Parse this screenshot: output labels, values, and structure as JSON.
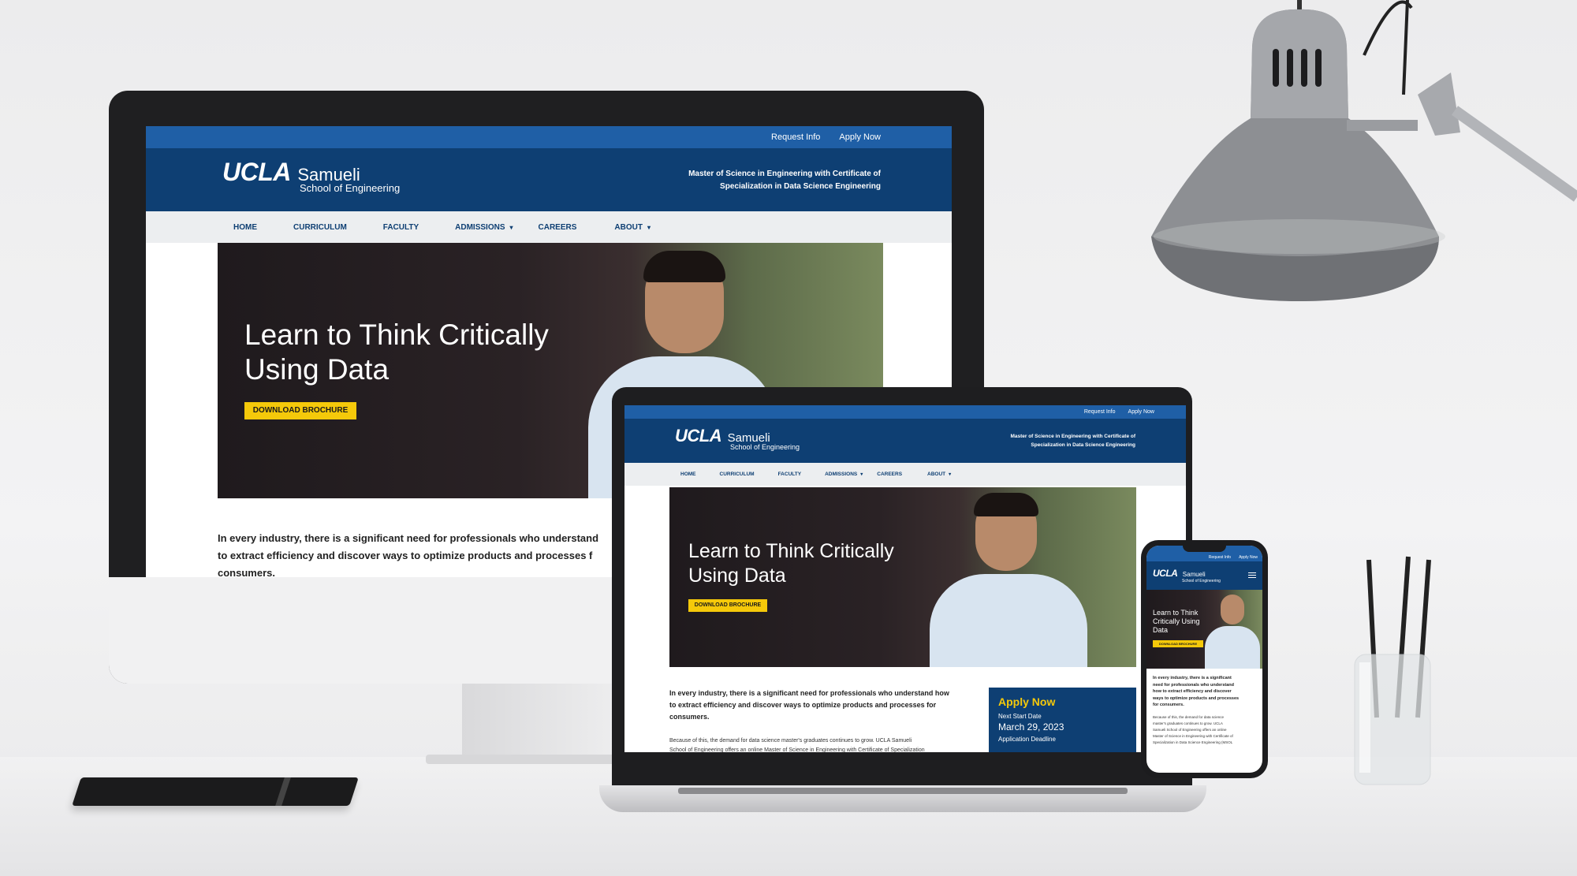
{
  "site": {
    "topbar": {
      "request_info": "Request Info",
      "apply_now": "Apply Now"
    },
    "logo": {
      "ucla": "UCLA",
      "samueli": "Samueli",
      "school": "School of Engineering"
    },
    "program": {
      "line1": "Master of Science in Engineering with Certificate of",
      "line2": "Specialization in Data Science Engineering"
    },
    "nav": [
      "HOME",
      "CURRICULUM",
      "FACULTY",
      "ADMISSIONS",
      "CAREERS",
      "ABOUT"
    ],
    "hero": {
      "headline_line1": "Learn to Think Critically",
      "headline_line2": "Using Data",
      "button": "DOWNLOAD BROCHURE"
    },
    "mobile_headline": {
      "line1": "Learn to Think",
      "line2": "Critically Using",
      "line3": "Data"
    },
    "intro": {
      "line1": "In every industry, there is a significant need for professionals who understand how",
      "line2": "to extract efficiency and discover ways to optimize products and processes for",
      "line3": "consumers."
    },
    "desktop_intro": {
      "line1": "In every industry, there is a significant need for professionals who understand",
      "line2": "to extract efficiency and discover ways to optimize products and processes f",
      "line3": "consumers."
    },
    "mobile_intro": {
      "line1": "In every industry, there is a significant",
      "line2": "need for professionals who understand",
      "line3": "how to extract efficiency and discover",
      "line4": "ways to optimize products and processes",
      "line5": "for consumers."
    },
    "body2": {
      "line1": "Because of this, the demand for data science master's graduates continues to grow. UCLA Samueli",
      "line2": "School of Engineering offers an online Master of Science in Engineering with Certificate of Specialization"
    },
    "mobile_body2": {
      "line1": "Because of this, the demand for data science",
      "line2": "master's graduates continues to grow. UCLA",
      "line3": "Samueli School of Engineering offers an online",
      "line4": "Master of Science in Engineering with Certificate of",
      "line5": "Specialization in Data Science Engineering (MSOL"
    },
    "apply_box": {
      "title": "Apply Now",
      "next_start_label": "Next Start Date",
      "next_start_date": "March 29, 2023",
      "deadline_label": "Application Deadline"
    }
  },
  "colors": {
    "dark_blue": "#0e3f73",
    "bright_blue": "#1f5fa6",
    "gold": "#f5c90a"
  }
}
